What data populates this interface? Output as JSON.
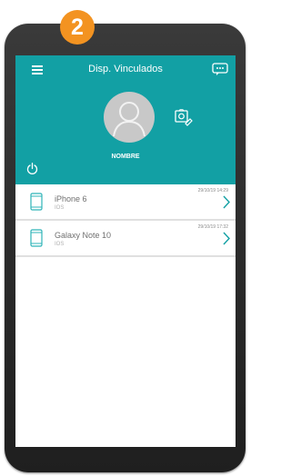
{
  "step": {
    "number": "2",
    "color": "#f39321"
  },
  "header": {
    "title": "Disp. Vinculados",
    "background": "#12a0a4",
    "menu_icon": "hamburger-menu-icon",
    "chat_icon": "chat-icon"
  },
  "profile": {
    "name": "NOMBRE",
    "avatar_icon": "user-avatar-icon",
    "photo_icon": "photo-edit-icon",
    "power_icon": "power-icon"
  },
  "devices": [
    {
      "name": "iPhone 6",
      "os": "IOS",
      "date": "29/10/19  14:29",
      "icon": "smartphone-icon"
    },
    {
      "name": "Galaxy Note 10",
      "os": "IOS",
      "date": "29/10/19  17:32",
      "icon": "smartphone-icon"
    }
  ],
  "colors": {
    "accent": "#12a0a4",
    "badge": "#f39321",
    "phone_frame": "#2b2b2b",
    "device_icon": "#2fb4b8"
  }
}
